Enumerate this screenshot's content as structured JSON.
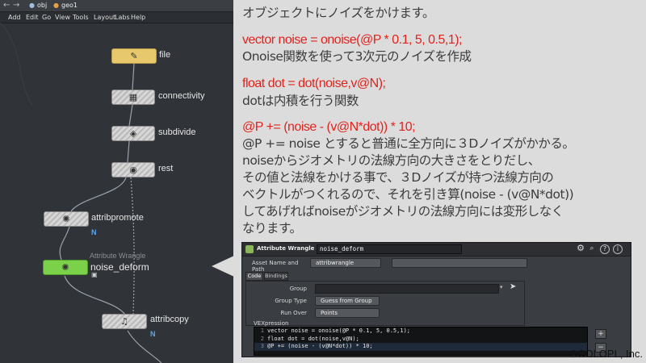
{
  "pathbar": {
    "back_glyph": "←",
    "forward_glyph": "→",
    "crumbs": [
      "obj",
      "geo1"
    ]
  },
  "menubar": {
    "items": [
      "Add",
      "Edit",
      "Go",
      "View",
      "Tools",
      "Layout",
      "Labs",
      "Help"
    ]
  },
  "nodes": {
    "file": {
      "label": "file",
      "icon": "file-icon"
    },
    "connectivity": {
      "label": "connectivity",
      "icon": "connectivity-icon"
    },
    "subdivide": {
      "label": "subdivide",
      "icon": "subdivide-icon"
    },
    "rest": {
      "label": "rest",
      "icon": "rest-icon"
    },
    "attribpromote": {
      "label": "attribpromote",
      "flag": "N",
      "icon": "attribpromote-icon"
    },
    "noise_deform": {
      "type_label": "Attribute Wrangle",
      "label": "noise_deform",
      "lock_glyph": "🔒",
      "icon": "wrangle-icon"
    },
    "attribcopy": {
      "label": "attribcopy",
      "flag": "N",
      "icon": "attribcopy-icon"
    }
  },
  "callout": {
    "line1": "オブジェクトにノイズをかけます。",
    "code1": "vector noise = onoise(@P * 0.1, 5, 0.5,1);",
    "desc1": "Onoise関数を使って3次元のノイズを作成",
    "code2": "float dot = dot(noise,v@N);",
    "desc2": "dotは内積を行う関数",
    "code3": "@P += (noise - (v@N*dot)) * 10;",
    "expl": [
      "@P += noise とすると普通に全方向に３Dノイズがかかる。",
      "noiseからジオメトリの法線方向の大きさをとりだし、",
      "その値と法線をかける事で、３Dノイズが持つ法線方向の",
      "ベクトルがつくれるので、それを引き算(noise - (v@N*dot))",
      "してあげればnoiseがジオメトリの法線方向には変形しなく",
      "なります。"
    ]
  },
  "params": {
    "node_type": "Attribute Wrangle",
    "node_name": "noise_deform",
    "asset_label": "Asset Name and Path",
    "asset_value": "attribwrangle",
    "tabs": [
      "Code",
      "Bindings"
    ],
    "group_label": "Group",
    "group_value": "",
    "group_type_label": "Group Type",
    "group_type_value": "Guess from Group",
    "run_over_label": "Run Over",
    "run_over_value": "Points",
    "vex_label": "VEXpression",
    "code_lines": [
      {
        "num": "1",
        "text": "vector noise = onoise(@P * 0.1, 5, 0.5,1);"
      },
      {
        "num": "2",
        "text": "float dot = dot(noise,v@N);"
      },
      {
        "num": "3",
        "text": "@P += (noise - (v@N*dot)) * 10;"
      }
    ],
    "side_plus": "+",
    "side_minus": "−",
    "icons": [
      "gear-icon",
      "search-icon",
      "help-icon",
      "info-icon"
    ]
  },
  "copyright": "©COLOPL, Inc."
}
